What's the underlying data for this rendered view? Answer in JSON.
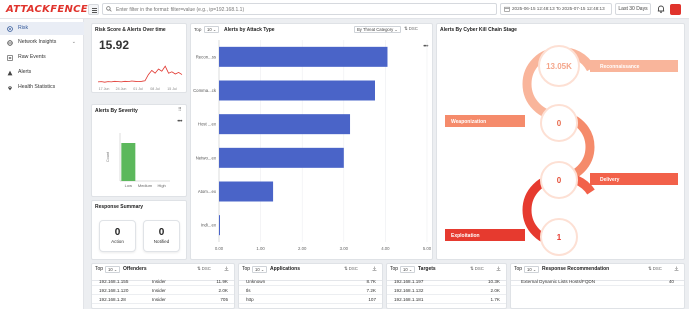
{
  "app": {
    "logo": "ATTACKFENCE"
  },
  "header": {
    "search_placeholder": "Enter filter in the format: filter=value (e.g., ip=192.168.1.1)",
    "date_range": "2025-06-15 12:48:13 To 2025-07-15 12:48:13",
    "period": "Last 30 Days"
  },
  "sidebar": {
    "items": [
      {
        "label": "Risk",
        "active": true
      },
      {
        "label": "Network Insights",
        "chevron": "⌄"
      },
      {
        "label": "Raw Events"
      },
      {
        "label": "Alerts"
      },
      {
        "label": "Health Statistics"
      }
    ]
  },
  "risk_score": {
    "title": "Risk Score & Alerts Over time",
    "value": "15.92",
    "x_ticks": [
      "17 Jun",
      "24 Jun",
      "01 Jul",
      "08 Jul",
      "15 Jul"
    ],
    "color": "#e0332c"
  },
  "severity": {
    "title": "Alerts By Severity",
    "y_label": "Count",
    "categories": [
      "Low",
      "Medium",
      "High"
    ],
    "color": "#5cb85c"
  },
  "response_summary": {
    "title": "Response Summary",
    "cards": [
      {
        "value": "0",
        "label": "Action"
      },
      {
        "value": "0",
        "label": "Notified"
      }
    ]
  },
  "attack_type": {
    "title": "Alerts by Attack Type",
    "top_label": "Top",
    "top_value": "10",
    "group_select": "By Threat Category",
    "sort": "DSC",
    "bar_color": "#4a64c8"
  },
  "kill_chain": {
    "title": "Alerts By Cyber Kill Chain Stage",
    "stages": [
      {
        "name": "Reconnaissance",
        "value": "13.05K",
        "color": "#f9b59b"
      },
      {
        "name": "Weaponization",
        "value": "0",
        "color": "#f58b6b"
      },
      {
        "name": "Delivery",
        "value": "0",
        "color": "#f2614a"
      },
      {
        "name": "Exploitation",
        "value": "1",
        "color": "#e63a2f"
      }
    ]
  },
  "offenders": {
    "top_label": "Top",
    "top_value": "10",
    "title": "Offenders",
    "sort": "DSC",
    "rows": [
      {
        "ip": "192.168.1.155",
        "type": "Insider",
        "count": "11.9K"
      },
      {
        "ip": "192.168.1.120",
        "type": "Insider",
        "count": "2.0K"
      },
      {
        "ip": "192.168.1.28",
        "type": "Insider",
        "count": "705"
      }
    ]
  },
  "applications": {
    "top_label": "Top",
    "top_value": "10",
    "title": "Applications",
    "sort": "DSC",
    "rows": [
      {
        "name": "Unknown",
        "count": "8.7K"
      },
      {
        "name": "tls",
        "count": "7.2K"
      },
      {
        "name": "http",
        "count": "107"
      }
    ]
  },
  "targets": {
    "top_label": "Top",
    "top_value": "10",
    "title": "Targets",
    "sort": "DSC",
    "rows": [
      {
        "ip": "192.168.1.197",
        "count": "10.3K"
      },
      {
        "ip": "192.168.1.132",
        "count": "2.0K"
      },
      {
        "ip": "192.168.1.181",
        "count": "1.7K"
      }
    ]
  },
  "response_rec": {
    "top_label": "Top",
    "top_value": "10",
    "title": "Response Recommendation",
    "sort": "DSC",
    "rows": [
      {
        "name": "External Dynamic Lists Hosts/FQDN",
        "count": "40"
      }
    ]
  },
  "chart_data": [
    {
      "type": "bar",
      "title": "Alerts by Attack Type",
      "orientation": "horizontal",
      "categories": [
        "Recon...ss",
        "Comma...ck",
        "Host ...ex",
        "Netwo...ex",
        "Atom...ex",
        "Indi...ex"
      ],
      "values": [
        4.05,
        3.75,
        3.15,
        3.0,
        1.3,
        0.02
      ],
      "x_ticks": [
        "0.00",
        "1.00",
        "2.00",
        "3.00",
        "4.00",
        "5.00"
      ],
      "xlim": [
        0,
        5
      ]
    },
    {
      "type": "line",
      "title": "Risk Score & Alerts Over time",
      "x": [
        "17 Jun",
        "24 Jun",
        "01 Jul",
        "08 Jul",
        "15 Jul"
      ],
      "series": [
        {
          "values": [
            0.04,
            0.05,
            0.03,
            0.05,
            0.04,
            0.06,
            0.05,
            0.04,
            0.06,
            0.05,
            0.07,
            0.06,
            0.05,
            0.06,
            0.08,
            0.3,
            0.45,
            0.35,
            0.5,
            0.42,
            0.6,
            0.35,
            0.4,
            0.32,
            0.38,
            0.3
          ]
        }
      ]
    },
    {
      "type": "bar",
      "title": "Alerts By Severity",
      "categories": [
        "Low",
        "Medium",
        "High"
      ],
      "values": [
        1,
        0,
        0
      ],
      "ylabel": "Count"
    }
  ]
}
